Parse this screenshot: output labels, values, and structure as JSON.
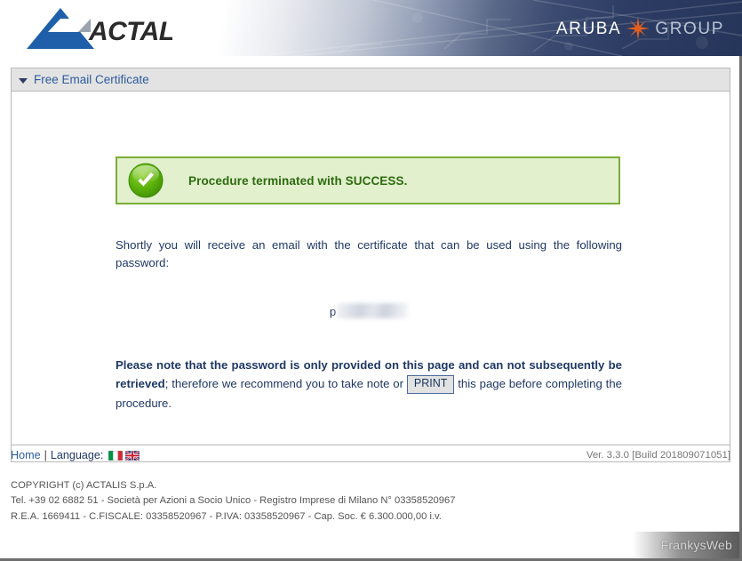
{
  "header": {
    "logo_text": "ACTALIS",
    "logo_icon": "actalis-triangle-logo",
    "aruba_word1": "ARUBA",
    "aruba_star_icon": "orange-star-icon",
    "aruba_word2": "GROUP"
  },
  "panel": {
    "toggle_icon": "triangle-down-icon",
    "title": "Free Email Certificate"
  },
  "success": {
    "icon": "green-check-circle-icon",
    "message": "Procedure terminated with SUCCESS."
  },
  "content": {
    "intro": "Shortly you will receive an email with the certificate that can be used using the following password:",
    "password_prefix": "p",
    "password_redacted": true,
    "warning_bold": "Please note that the password is only provided on this page and can not subsequently be retrieved",
    "warning_mid": "; therefore we recommend you to take note or",
    "print_label": "PRINT",
    "warning_end": "this page before completing the procedure."
  },
  "footer": {
    "home_label": "Home",
    "separator": "|",
    "language_label": "Language:",
    "flag_it": "italy-flag-icon",
    "flag_en": "united-kingdom-flag-icon",
    "version": "Ver. 3.3.0 [Build 201809071051]",
    "copyright_line1": "COPYRIGHT (c) ACTALIS S.p.A.",
    "copyright_line2": "Tel. +39 02 6882 51 - Società per Azioni a Socio Unico - Registro Imprese di Milano N° 03358520967",
    "copyright_line3": "R.E.A. 1669411 - C.FISCALE: 03358520967 - P.IVA: 03358520967 - Cap. Soc. € 6.300.000,00 i.v."
  },
  "watermark": {
    "text": "FrankysWeb"
  },
  "colors": {
    "header_dark": "#26355a",
    "link_blue": "#2c5b9e",
    "text_navy": "#1f3864",
    "success_bg": "#e2f0cd",
    "success_border": "#7aad3a",
    "success_text": "#2e6b10",
    "logo_blue": "#1f5fa9",
    "aruba_orange": "#e8601c"
  }
}
